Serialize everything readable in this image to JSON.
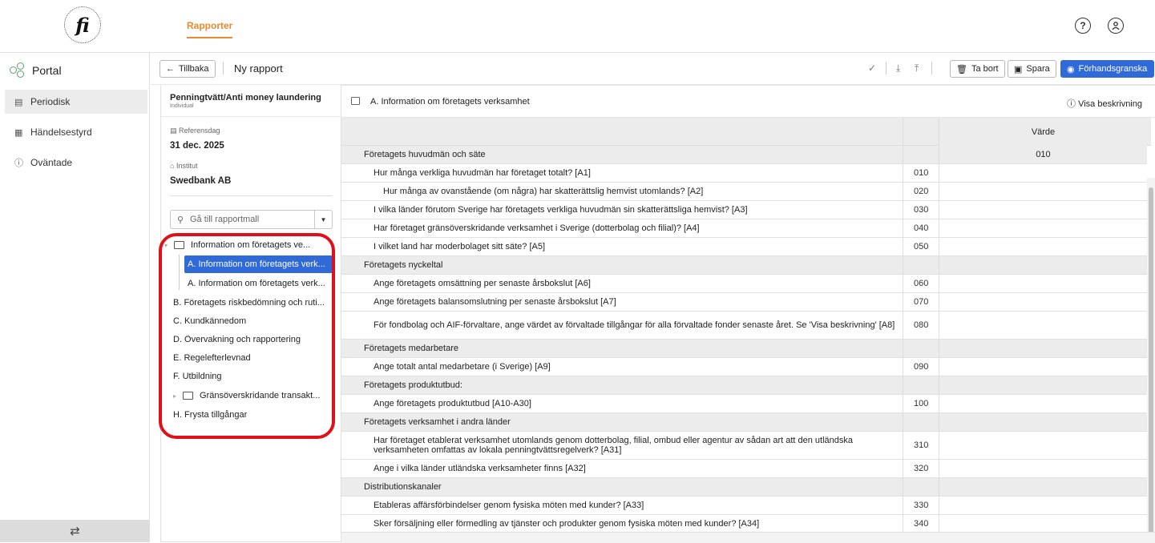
{
  "app": {
    "logo_text": "fi",
    "nav_tab": "Rapporter",
    "help_icon": "?",
    "user_icon": "user-icon"
  },
  "sidebar": {
    "portal_label": "Portal",
    "items": [
      {
        "label": "Periodisk",
        "icon": "▤",
        "active": true
      },
      {
        "label": "Händelsestyrd",
        "icon": "▦",
        "active": false
      },
      {
        "label": "Oväntade",
        "icon": "ⓘ",
        "active": false
      }
    ],
    "footer_icon": "⇄"
  },
  "toolbar": {
    "back_label": "Tillbaka",
    "title": "Ny rapport",
    "delete_label": "Ta bort",
    "save_label": "Spara",
    "preview_label": "Förhandsgranska"
  },
  "report": {
    "name": "Penningtvätt/Anti money laundering",
    "type": "Individual",
    "ref_label": "Referensdag",
    "ref_value": "31 dec. 2025",
    "inst_label": "Institut",
    "inst_value": "Swedbank AB",
    "search_placeholder": "Gå till rapportmall"
  },
  "tree": [
    {
      "label": "Information om företagets ve...",
      "kind": "folder",
      "expanded": true
    },
    {
      "label": "A. Information om företagets verk...",
      "kind": "leaf",
      "selected": true
    },
    {
      "label": "A. Information om företagets verk...",
      "kind": "leaf",
      "selected": false
    },
    {
      "label": "B. Företagets riskbedömning och ruti...",
      "kind": "item"
    },
    {
      "label": "C. Kundkännedom",
      "kind": "item"
    },
    {
      "label": "D. Övervakning och rapportering",
      "kind": "item"
    },
    {
      "label": "E. Regelefterlevnad",
      "kind": "item"
    },
    {
      "label": "F. Utbildning",
      "kind": "item"
    },
    {
      "label": "Gränsöverskridande transakt...",
      "kind": "folder",
      "expanded": false
    },
    {
      "label": "H. Frysta tillgångar",
      "kind": "item"
    }
  ],
  "section": {
    "title": "A. Information om företagets verksamhet",
    "description_label": "Visa beskrivning",
    "value_col_header": "Värde",
    "value_col_code": "010"
  },
  "rows": [
    {
      "label": "Företagets huvudmän och säte",
      "code": "",
      "type": "grp"
    },
    {
      "label": "Hur många verkliga huvudmän har företaget totalt? [A1]",
      "code": "010",
      "type": "child"
    },
    {
      "label": "Hur många av ovanstående (om några) har skatterättslig hemvist utomlands? [A2]",
      "code": "020",
      "type": "child2"
    },
    {
      "label": "I vilka länder förutom Sverige har företagets verkliga huvudmän sin skatterättsliga hemvist? [A3]",
      "code": "030",
      "type": "child"
    },
    {
      "label": "Har företaget gränsöverskridande verksamhet i Sverige (dotterbolag och filial)? [A4]",
      "code": "040",
      "type": "child"
    },
    {
      "label": "I vilket land har moderbolaget sitt säte? [A5]",
      "code": "050",
      "type": "child"
    },
    {
      "label": "Företagets nyckeltal",
      "code": "",
      "type": "grp"
    },
    {
      "label": "Ange företagets omsättning per senaste årsbokslut [A6]",
      "code": "060",
      "type": "child"
    },
    {
      "label": "Ange företagets balansomslutning per senaste årsbokslut [A7]",
      "code": "070",
      "type": "child"
    },
    {
      "label": "För fondbolag och AIF-förvaltare, ange värdet av förvaltade tillgångar för alla förvaltade fonder senaste året. Se 'Visa beskrivning' [A8]",
      "code": "080",
      "type": "child",
      "tall": true
    },
    {
      "label": "Företagets medarbetare",
      "code": "",
      "type": "grp"
    },
    {
      "label": "Ange totalt antal medarbetare (i Sverige) [A9]",
      "code": "090",
      "type": "child"
    },
    {
      "label": "Företagets produktutbud:",
      "code": "",
      "type": "grp"
    },
    {
      "label": "Ange företagets produktutbud [A10-A30]",
      "code": "100",
      "type": "child"
    },
    {
      "label": "Företagets verksamhet i andra länder",
      "code": "",
      "type": "grp"
    },
    {
      "label": "Har företaget etablerat verksamhet utomlands genom dotterbolag, filial, ombud eller agentur av sådan art att den utländska verksamheten omfattas av lokala penningtvättsregelverk? [A31]",
      "code": "310",
      "type": "child",
      "tall": true
    },
    {
      "label": "Ange i vilka länder utländska verksamheter finns [A32]",
      "code": "320",
      "type": "child"
    },
    {
      "label": "Distributionskanaler",
      "code": "",
      "type": "grp"
    },
    {
      "label": "Etableras affärsförbindelser genom fysiska möten med kunder? [A33]",
      "code": "330",
      "type": "child"
    },
    {
      "label": "Sker försäljning eller förmedling av tjänster och produkter genom fysiska möten med kunder? [A34]",
      "code": "340",
      "type": "child"
    }
  ]
}
